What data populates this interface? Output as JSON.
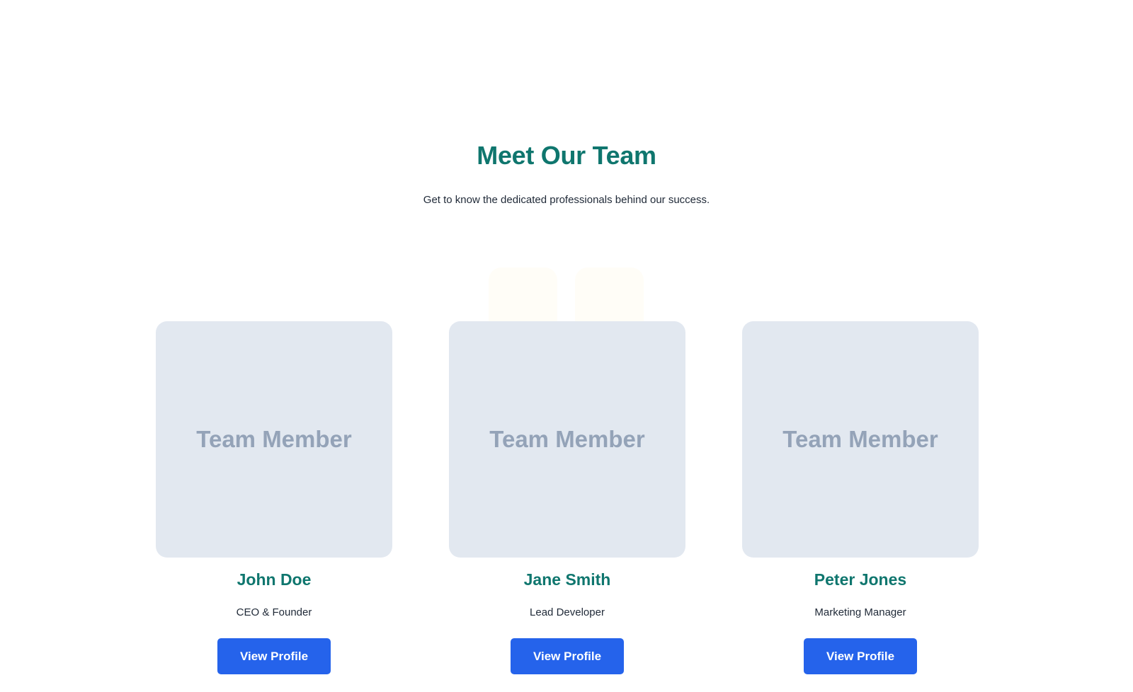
{
  "section": {
    "title": "Meet Our Team",
    "subtitle": "Get to know the dedicated professionals behind our success."
  },
  "members": [
    {
      "placeholder": "Team Member",
      "name": "John Doe",
      "role": "CEO & Founder",
      "button_label": "View Profile"
    },
    {
      "placeholder": "Team Member",
      "name": "Jane Smith",
      "role": "Lead Developer",
      "button_label": "View Profile"
    },
    {
      "placeholder": "Team Member",
      "name": "Peter Jones",
      "role": "Marketing Manager",
      "button_label": "View Profile"
    }
  ],
  "colors": {
    "heading": "#0f766e",
    "text": "#1f2937",
    "photo_bg": "#e2e8f0",
    "photo_text": "#94a3b8",
    "button_bg": "#2563eb",
    "button_text": "#ffffff"
  }
}
